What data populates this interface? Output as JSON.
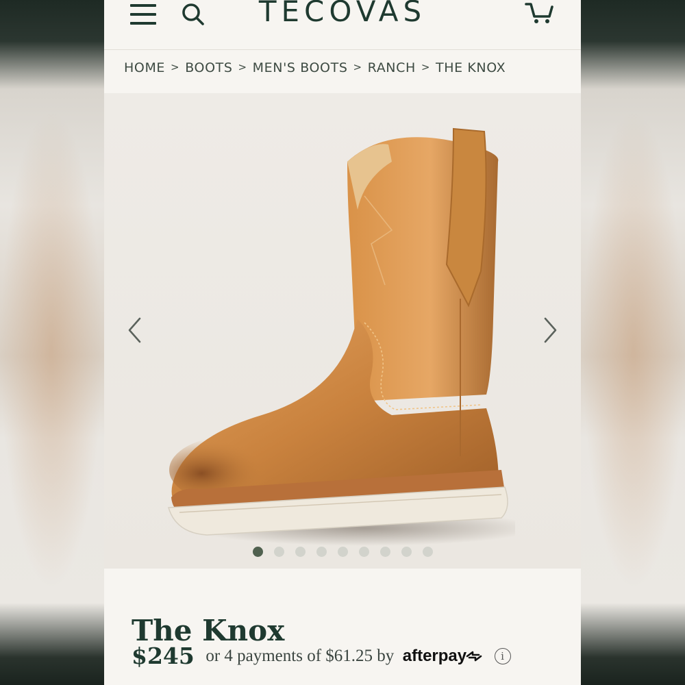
{
  "header": {
    "logo": "TECOVAS"
  },
  "breadcrumb": [
    "HOME",
    "BOOTS",
    "MEN'S BOOTS",
    "RANCH",
    "THE KNOX"
  ],
  "breadcrumb_separator": ">",
  "gallery": {
    "image_alt": "The Knox boot",
    "slide_count": 9,
    "active_slide": 1
  },
  "product": {
    "title": "The Knox",
    "price": "$245",
    "installments": "or 4 payments of $61.25 by",
    "provider": "afterpay",
    "info_glyph": "i"
  },
  "icons": {
    "menu": "hamburger-menu-icon",
    "search": "search-icon",
    "cart": "cart-icon",
    "prev": "chevron-left-icon",
    "next": "chevron-right-icon",
    "info": "info-icon"
  },
  "colors": {
    "brand": "#1f3a30",
    "background": "#f7f5f1",
    "dot_active": "#50614f",
    "dot_inactive": "#d2d3cc"
  }
}
